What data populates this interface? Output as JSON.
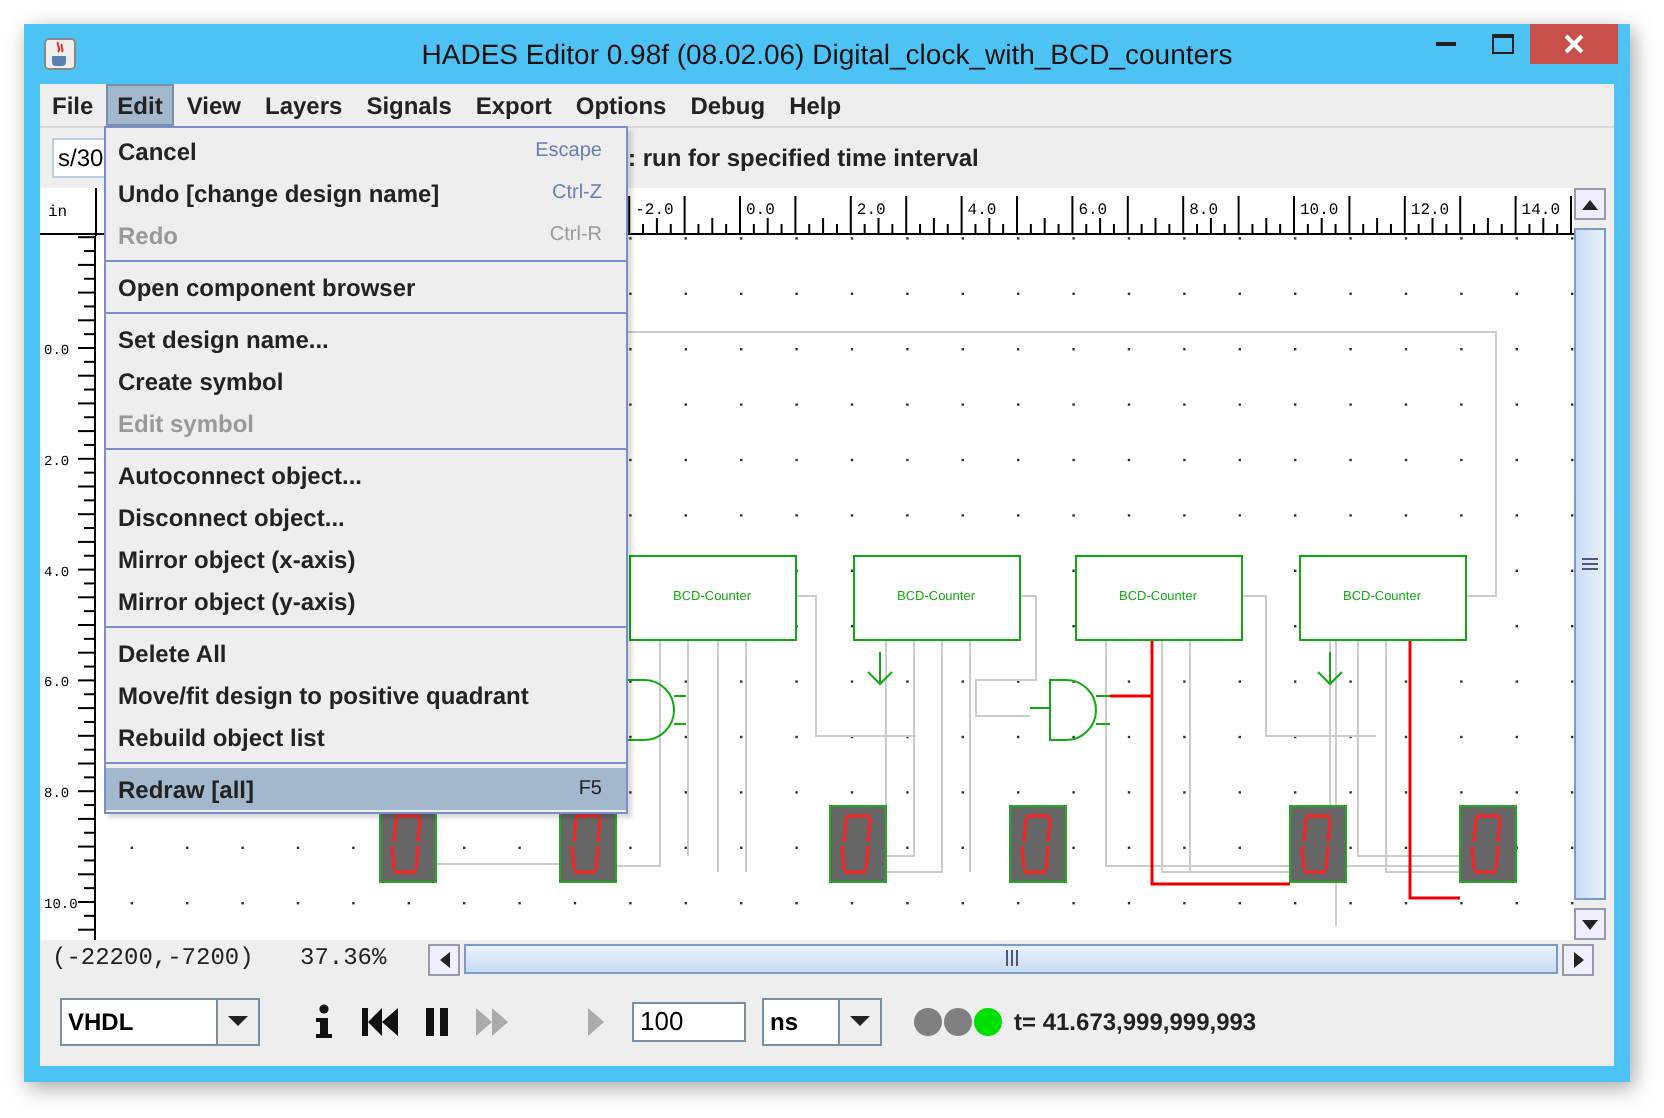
{
  "window": {
    "title": "HADES Editor 0.98f (08.02.06)    Digital_clock_with_BCD_counters"
  },
  "menubar": [
    {
      "label": "File",
      "selected": false
    },
    {
      "label": "Edit",
      "selected": true
    },
    {
      "label": "View",
      "selected": false
    },
    {
      "label": "Layers",
      "selected": false
    },
    {
      "label": "Signals",
      "selected": false
    },
    {
      "label": "Export",
      "selected": false
    },
    {
      "label": "Options",
      "selected": false
    },
    {
      "label": "Debug",
      "selected": false
    },
    {
      "label": "Help",
      "selected": false
    }
  ],
  "edit_menu": [
    {
      "kind": "item",
      "label": "Cancel",
      "shortcut": "Escape",
      "disabled": false,
      "selected": false
    },
    {
      "kind": "item",
      "label": "Undo [change design name]",
      "shortcut": "Ctrl-Z",
      "disabled": false,
      "selected": false
    },
    {
      "kind": "item",
      "label": "Redo",
      "shortcut": "Ctrl-R",
      "disabled": true,
      "selected": false
    },
    {
      "kind": "separator"
    },
    {
      "kind": "item",
      "label": "Open component browser",
      "disabled": false,
      "selected": false
    },
    {
      "kind": "separator"
    },
    {
      "kind": "item",
      "label": "Set design name...",
      "disabled": false,
      "selected": false
    },
    {
      "kind": "item",
      "label": "Create symbol",
      "disabled": false,
      "selected": false
    },
    {
      "kind": "item",
      "label": "Edit symbol",
      "disabled": true,
      "selected": false
    },
    {
      "kind": "separator"
    },
    {
      "kind": "item",
      "label": "Autoconnect object...",
      "disabled": false,
      "selected": false
    },
    {
      "kind": "item",
      "label": "Disconnect object...",
      "disabled": false,
      "selected": false
    },
    {
      "kind": "item",
      "label": "Mirror object (x-axis)",
      "disabled": false,
      "selected": false
    },
    {
      "kind": "item",
      "label": "Mirror object (y-axis)",
      "disabled": false,
      "selected": false
    },
    {
      "kind": "separator"
    },
    {
      "kind": "item",
      "label": "Delete All",
      "disabled": false,
      "selected": false
    },
    {
      "kind": "item",
      "label": "Move/fit design to positive quadrant",
      "disabled": false,
      "selected": false
    },
    {
      "kind": "item",
      "label": "Rebuild object list",
      "disabled": false,
      "selected": false
    },
    {
      "kind": "separator"
    },
    {
      "kind": "item",
      "label": "Redraw [all]",
      "shortcut": "F5",
      "disabled": false,
      "selected": true
    }
  ],
  "toolbar": {
    "time_field": "s/30",
    "hint": ": run for specified time interval"
  },
  "ruler": {
    "unit": "in",
    "top_labels": [
      "-2.0",
      "0.0",
      "2.0",
      "4.0",
      "6.0",
      "8.0",
      "10.0",
      "12.0",
      "14.0"
    ],
    "left_labels": [
      "0.0",
      "2.0",
      "4.0",
      "6.0",
      "8.0",
      "10.0"
    ]
  },
  "canvas": {
    "counters": [
      {
        "label": "BCD-Counter"
      },
      {
        "label": "BCD-Counter"
      },
      {
        "label": "BCD-Counter"
      },
      {
        "label": "BCD-Counter"
      }
    ]
  },
  "status": {
    "coordinates": "(-22200,-7200)",
    "zoom": "37.36%"
  },
  "controls": {
    "language": "VHDL",
    "buttons": [
      {
        "kind": "info",
        "disabled": false
      },
      {
        "kind": "rewind",
        "disabled": false
      },
      {
        "kind": "pause",
        "disabled": false
      },
      {
        "kind": "fast_forward",
        "disabled": true
      },
      {
        "kind": "play",
        "disabled": true
      }
    ],
    "run_time": "100",
    "unit": "ns",
    "indicators": [
      {
        "color": "#808080"
      },
      {
        "color": "#808080"
      },
      {
        "color": "#00e000"
      }
    ],
    "sim_time": "t= 41.673,999,999,993"
  }
}
